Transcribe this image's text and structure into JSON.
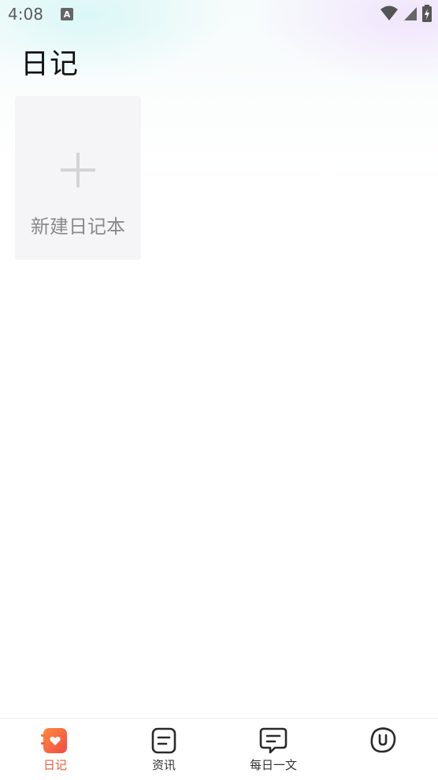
{
  "status_bar": {
    "time": "4:08",
    "notification_badge": "A",
    "icons": [
      "wifi-icon",
      "signal-icon",
      "battery-charging-icon"
    ]
  },
  "page": {
    "title": "日记"
  },
  "new_notebook": {
    "label": "新建日记本",
    "icon": "plus-icon"
  },
  "bottom_nav": {
    "active_color": "#ef5b3b",
    "items": [
      {
        "label": "日记",
        "icon": "notebook-heart-icon",
        "active": true
      },
      {
        "label": "资讯",
        "icon": "article-icon",
        "active": false
      },
      {
        "label": "每日一文",
        "icon": "chat-bubble-icon",
        "active": false
      },
      {
        "label": "",
        "icon": "profile-face-icon",
        "active": false
      }
    ]
  }
}
